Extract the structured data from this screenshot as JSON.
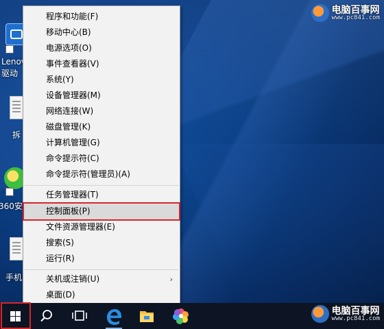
{
  "watermark": {
    "title": "电脑百事网",
    "url": "www.pc841.com"
  },
  "desktop_icons": [
    {
      "label": "Lenovo\n驱动",
      "icon": "lenovo-driver-icon"
    },
    {
      "label": "拆",
      "icon": "document-file-icon"
    },
    {
      "label": "360安",
      "icon": "security-guard-icon"
    },
    {
      "label": "手机",
      "icon": "document-file-icon"
    }
  ],
  "context_menu": {
    "groups": [
      [
        "程序和功能(F)",
        "移动中心(B)",
        "电源选项(O)",
        "事件查看器(V)",
        "系统(Y)",
        "设备管理器(M)",
        "网络连接(W)",
        "磁盘管理(K)",
        "计算机管理(G)",
        "命令提示符(C)",
        "命令提示符(管理员)(A)"
      ],
      [
        "任务管理器(T)",
        "控制面板(P)",
        "文件资源管理器(E)",
        "搜索(S)",
        "运行(R)"
      ],
      [
        "关机或注销(U)",
        "桌面(D)"
      ]
    ],
    "selected": "控制面板(P)",
    "submenu_arrow": "›"
  },
  "taskbar": {
    "icons": [
      "windows-start-icon",
      "search-icon",
      "task-view-icon",
      "edge-browser-icon",
      "file-explorer-icon",
      "color-app-icon"
    ]
  },
  "colors": {
    "highlight": "#d7262a",
    "taskbar": "#0d1524",
    "menu_bg": "#f2f2f2"
  }
}
